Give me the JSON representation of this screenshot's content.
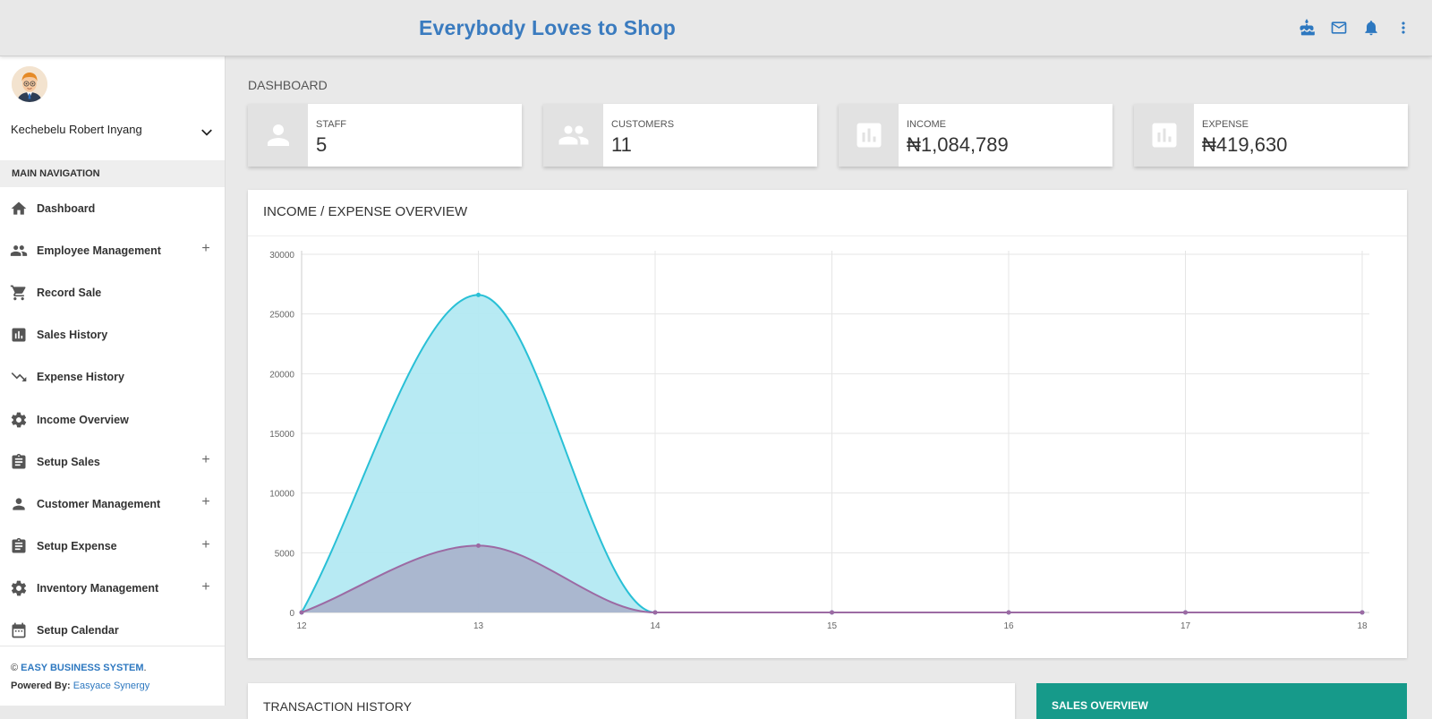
{
  "header": {
    "title": "Everybody Loves to Shop",
    "icons": [
      "cake-icon",
      "mail-icon",
      "bell-icon",
      "more-vert-icon"
    ]
  },
  "user": {
    "name": "Kechebelu Robert Inyang"
  },
  "sidebar": {
    "nav_header": "MAIN NAVIGATION",
    "items": [
      {
        "label": "Dashboard",
        "icon": "home-icon",
        "expandable": false
      },
      {
        "label": "Employee Management",
        "icon": "people-icon",
        "expandable": true
      },
      {
        "label": "Record Sale",
        "icon": "cart-icon",
        "expandable": false
      },
      {
        "label": "Sales History",
        "icon": "bar-chart-icon",
        "expandable": false
      },
      {
        "label": "Expense History",
        "icon": "trending-down-icon",
        "expandable": false
      },
      {
        "label": "Income Overview",
        "icon": "gear-icon",
        "expandable": false
      },
      {
        "label": "Setup Sales",
        "icon": "clipboard-icon",
        "expandable": true
      },
      {
        "label": "Customer Management",
        "icon": "person-icon",
        "expandable": true
      },
      {
        "label": "Setup Expense",
        "icon": "clipboard-icon",
        "expandable": true
      },
      {
        "label": "Inventory Management",
        "icon": "gear-icon",
        "expandable": true
      },
      {
        "label": "Setup Calendar",
        "icon": "calendar-icon",
        "expandable": false
      }
    ],
    "plus_symbol": "+",
    "footer": {
      "copyright": "©",
      "brand": "EASY BUSINESS SYSTEM",
      "period": ".",
      "powered_label": "Powered By:",
      "powered_link": "Easyace Synergy"
    }
  },
  "main": {
    "heading": "DASHBOARD",
    "stats": [
      {
        "label": "STAFF",
        "value": "5",
        "icon": "person-icon"
      },
      {
        "label": "CUSTOMERS",
        "value": "11",
        "icon": "people-icon"
      },
      {
        "label": "INCOME",
        "value": "₦1,084,789",
        "icon": "bar-chart-icon"
      },
      {
        "label": "EXPENSE",
        "value": "₦419,630",
        "icon": "bar-chart-icon"
      }
    ],
    "chart_panel_title": "INCOME / EXPENSE OVERVIEW",
    "transaction_title": "TRANSACTION HISTORY",
    "sales_title": "SALES OVERVIEW"
  },
  "chart_data": {
    "type": "area",
    "x": [
      12,
      13,
      14,
      15,
      16,
      17,
      18
    ],
    "series": [
      {
        "values": [
          0,
          26600,
          0,
          0,
          0,
          0,
          0
        ],
        "color": "#29c0d6",
        "fill": "#b3e9f2"
      },
      {
        "values": [
          0,
          5600,
          0,
          0,
          0,
          0,
          0
        ],
        "color": "#9c6aa3",
        "fill": "#a9b4cc"
      }
    ],
    "ylim": [
      0,
      30000
    ],
    "yticks": [
      0,
      5000,
      10000,
      15000,
      20000,
      25000,
      30000
    ],
    "grid": true
  },
  "colors": {
    "accent": "#2d78c0",
    "teal": "#169a8a"
  }
}
